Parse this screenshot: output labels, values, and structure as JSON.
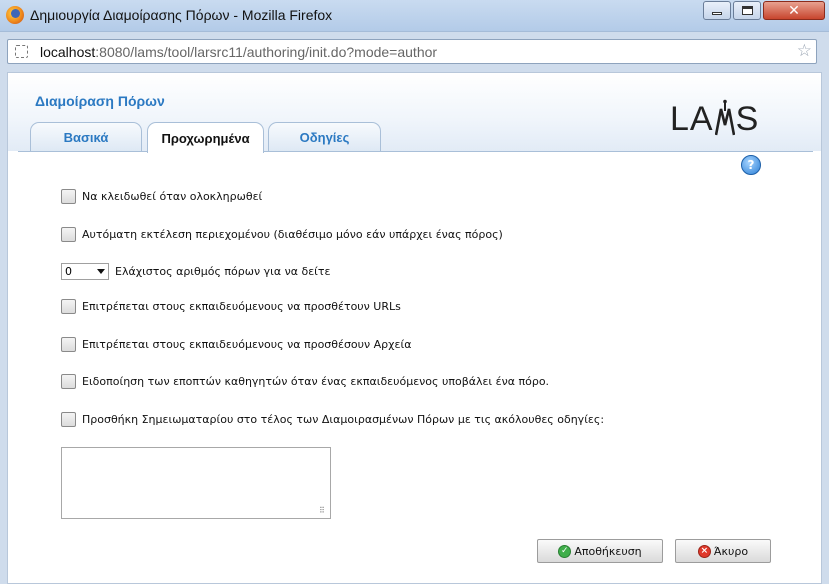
{
  "window": {
    "title": "Δημιουργία Διαμοίρασης Πόρων - Mozilla Firefox",
    "close_glyph": "✕"
  },
  "urlbar": {
    "host": "localhost",
    "path": ":8080/lams/tool/larsrc11/authoring/init.do?mode=author"
  },
  "page": {
    "title": "Διαμοίραση Πόρων",
    "logo_left": "LA",
    "logo_right": "S",
    "tabs": [
      {
        "label": "Βασικά",
        "active": false
      },
      {
        "label": "Προχωρημένα",
        "active": true
      },
      {
        "label": "Οδηγίες",
        "active": false
      }
    ],
    "help_glyph": "?"
  },
  "options": {
    "lock_on_finish": "Να κλειδωθεί όταν ολοκληρωθεί",
    "run_auto": "Αυτόματη εκτέλεση περιεχομένου (διαθέσιμο μόνο εάν υπάρχει ένας πόρος)",
    "min_view_value": "0",
    "min_view_label": "Ελάχιστος αριθμός πόρων για να δείτε",
    "allow_urls": "Επιτρέπεται στους εκπαιδευόμενους να προσθέτουν URLs",
    "allow_files": "Επιτρέπεται στους εκπαιδευόμενους να προσθέσουν Αρχεία",
    "notify_teachers": "Ειδοποίηση των εποπτών καθηγητών όταν ένας εκπαιδευόμενος υποβάλει ένα πόρο.",
    "notebook": "Προσθήκη Σημειωματαρίου στο τέλος των Διαμοιρασμένων Πόρων με τις ακόλουθες οδηγίες:"
  },
  "buttons": {
    "save": "Αποθήκευση",
    "cancel": "Άκυρο"
  },
  "colors": {
    "accent": "#2b79c2",
    "titlebar": "#c9dbf0",
    "close": "#c8452e"
  }
}
